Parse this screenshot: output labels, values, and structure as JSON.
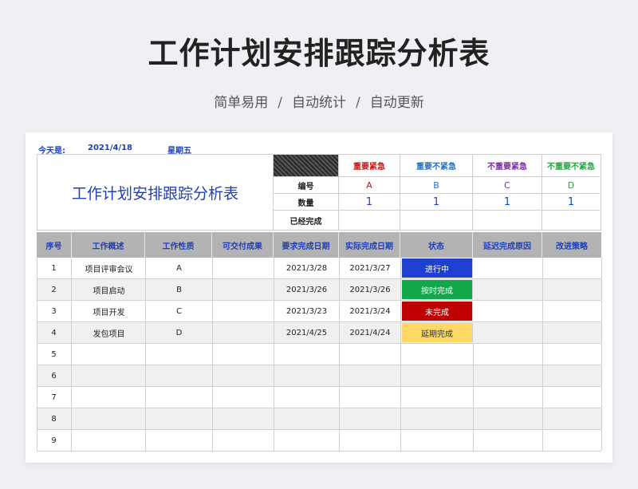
{
  "page": {
    "title": "工作计划安排跟踪分析表",
    "subtitle": [
      "简单易用",
      "自动统计",
      "自动更新"
    ],
    "subtitle_sep": "/"
  },
  "sheet": {
    "today_label": "今天是:",
    "today_date": "2021/4/18",
    "weekday": "星期五",
    "title": "工作计划安排跟踪分析表",
    "summary": {
      "row_labels": [
        "编号",
        "数量",
        "已经完成"
      ],
      "categories": [
        {
          "name": "重要紧急",
          "code": "A",
          "count": "1",
          "done": "",
          "color": "#cc1111"
        },
        {
          "name": "重要不紧急",
          "code": "B",
          "count": "1",
          "done": "",
          "color": "#1f6fc9"
        },
        {
          "name": "不重要紧急",
          "code": "C",
          "count": "1",
          "done": "",
          "color": "#7b2aa8"
        },
        {
          "name": "不重要不紧急",
          "code": "D",
          "count": "1",
          "done": "",
          "color": "#1ea83c"
        }
      ]
    },
    "table": {
      "headers": [
        "序号",
        "工作概述",
        "工作性质",
        "可交付成果",
        "要求完成日期",
        "实际完成日期",
        "状态",
        "延迟完成原因",
        "改进策略"
      ],
      "rows": [
        {
          "no": "1",
          "desc": "项目评审会议",
          "type": "A",
          "deliverable": "",
          "required": "2021/3/28",
          "actual": "2021/3/27",
          "status": "进行中",
          "status_color": "#1f3fd0",
          "reason": "",
          "strategy": ""
        },
        {
          "no": "2",
          "desc": "项目启动",
          "type": "B",
          "deliverable": "",
          "required": "2021/3/26",
          "actual": "2021/3/26",
          "status": "按时完成",
          "status_color": "#12a84a",
          "reason": "",
          "strategy": ""
        },
        {
          "no": "3",
          "desc": "项目开发",
          "type": "C",
          "deliverable": "",
          "required": "2021/3/23",
          "actual": "2021/3/24",
          "status": "未完成",
          "status_color": "#c00000",
          "reason": "",
          "strategy": ""
        },
        {
          "no": "4",
          "desc": "发包项目",
          "type": "D",
          "deliverable": "",
          "required": "2021/4/25",
          "actual": "2021/4/24",
          "status": "延期完成",
          "status_color": "#ffd966",
          "reason": "",
          "strategy": ""
        },
        {
          "no": "5",
          "desc": "",
          "type": "",
          "deliverable": "",
          "required": "",
          "actual": "",
          "status": "",
          "status_color": "",
          "reason": "",
          "strategy": ""
        },
        {
          "no": "6",
          "desc": "",
          "type": "",
          "deliverable": "",
          "required": "",
          "actual": "",
          "status": "",
          "status_color": "",
          "reason": "",
          "strategy": ""
        },
        {
          "no": "7",
          "desc": "",
          "type": "",
          "deliverable": "",
          "required": "",
          "actual": "",
          "status": "",
          "status_color": "",
          "reason": "",
          "strategy": ""
        },
        {
          "no": "8",
          "desc": "",
          "type": "",
          "deliverable": "",
          "required": "",
          "actual": "",
          "status": "",
          "status_color": "",
          "reason": "",
          "strategy": ""
        },
        {
          "no": "9",
          "desc": "",
          "type": "",
          "deliverable": "",
          "required": "",
          "actual": "",
          "status": "",
          "status_color": "",
          "reason": "",
          "strategy": ""
        }
      ]
    }
  }
}
